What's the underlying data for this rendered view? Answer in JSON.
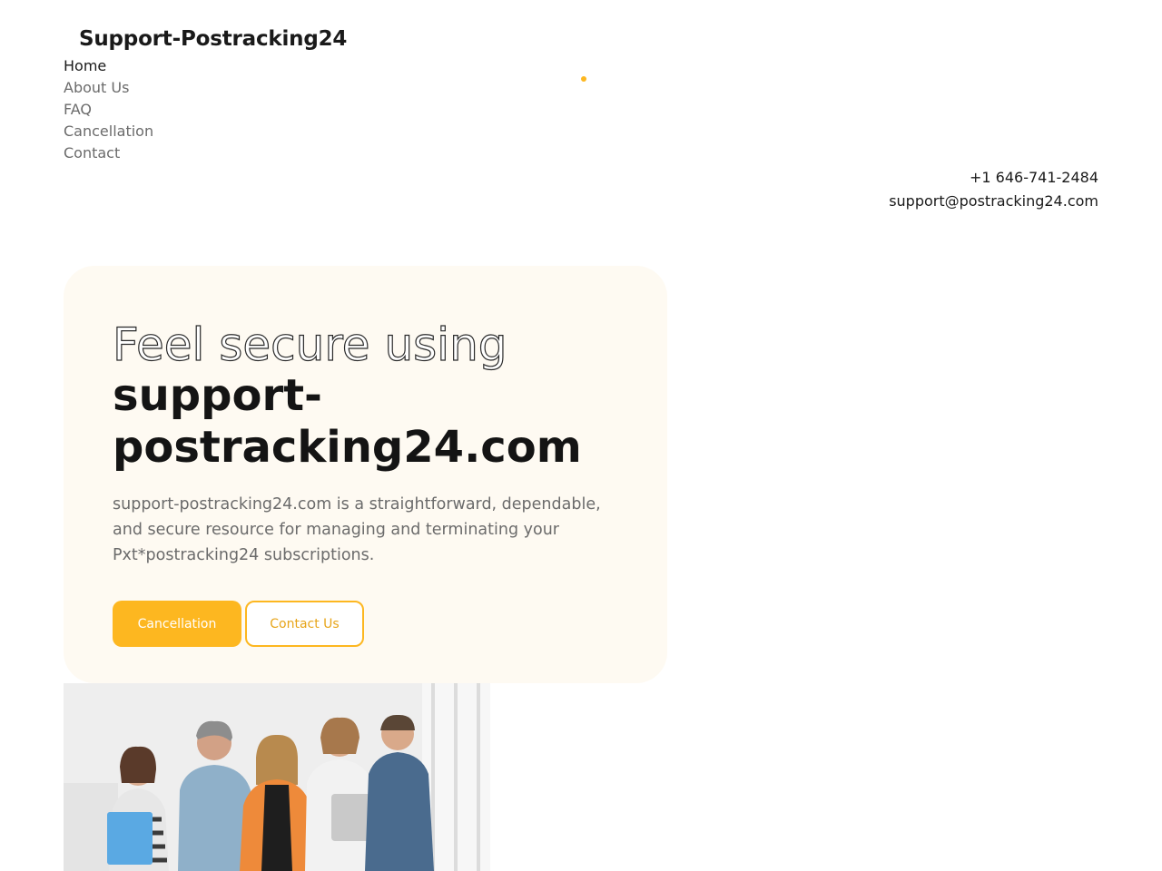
{
  "header": {
    "brand": "Support-Postracking24",
    "nav": [
      {
        "label": "Home",
        "active": true
      },
      {
        "label": "About Us",
        "active": false
      },
      {
        "label": "FAQ",
        "active": false
      },
      {
        "label": "Cancellation",
        "active": false
      },
      {
        "label": "Contact",
        "active": false
      }
    ],
    "phone": "+1 646-741-2484",
    "email": "support@postracking24.com"
  },
  "hero": {
    "headline_outline": "Feel secure using",
    "headline_solid": "support-postracking24.com",
    "description": "support-postracking24.com is a straightforward, dependable, and secure resource for managing and terminating your Pxt*postracking24 subscriptions.",
    "primary_button": "Cancellation",
    "secondary_button": "Contact Us"
  },
  "image": {
    "icon": "team-photo"
  },
  "colors": {
    "accent": "#fdb720",
    "card_bg": "#fefaf2",
    "text_dark": "#1a1a1a",
    "text_muted": "#6b6b6b"
  }
}
